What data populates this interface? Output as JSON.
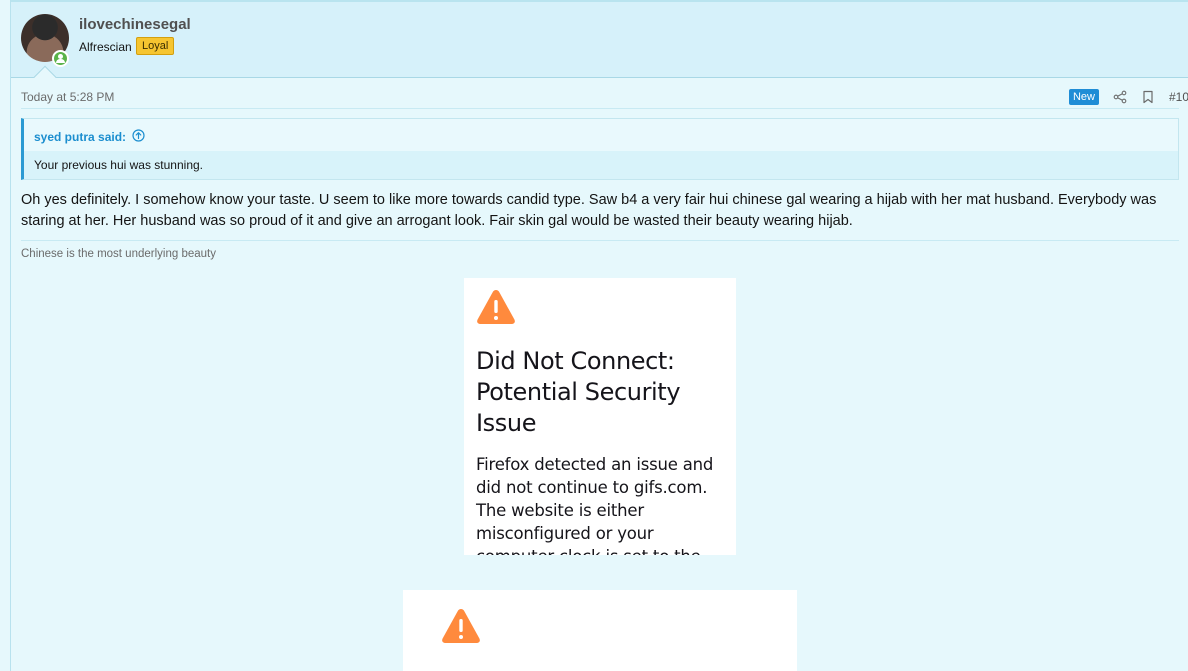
{
  "author": {
    "username": "ilovechinesegal",
    "title": "Alfrescian",
    "badge": "Loyal"
  },
  "post": {
    "date": "Today at 5:28 PM",
    "new_badge": "New",
    "number": "#10"
  },
  "quote": {
    "author": "syed putra said:",
    "text": "Your previous hui was stunning."
  },
  "message": "Oh yes definitely. I somehow know your taste. U seem to like more towards candid type. Saw b4 a very fair hui chinese gal wearing a hijab with her mat husband. Everybody was staring at her. Her husband was so proud of it and give an arrogant look. Fair skin gal would be wasted their beauty wearing hijab.",
  "signature": "Chinese is the most underlying beauty",
  "embeds": [
    {
      "title": "Did Not Connect: Potential Security Issue",
      "description": "Firefox detected an issue and did not continue to gifs.com. The website is either misconfigured or your computer clock is set to the"
    }
  ],
  "colors": {
    "accent": "#2b9ad3",
    "warning": "#ff8a3d",
    "badge_new": "#1f8dd6",
    "badge_loyal": "#f6c530",
    "online": "#5ab34a"
  },
  "icons": [
    "share-icon",
    "bookmark-icon",
    "arrow-up-circle-icon",
    "warning-icon",
    "user-online-icon"
  ]
}
